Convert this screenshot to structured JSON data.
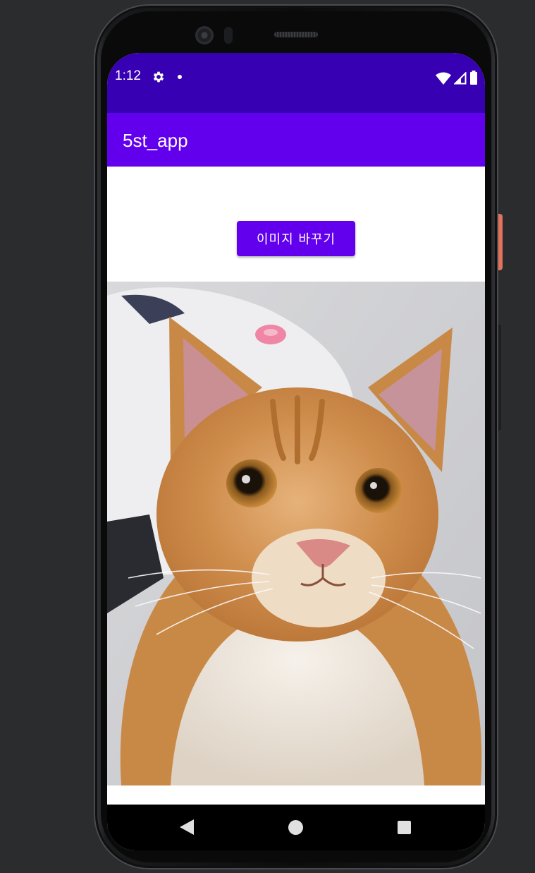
{
  "status_bar": {
    "time": "1:12",
    "icons": [
      "settings-gear-icon",
      "notification-dot-icon",
      "wifi-icon",
      "cell-signal-icon",
      "battery-icon"
    ]
  },
  "app_bar": {
    "title": "5st_app"
  },
  "main": {
    "change_image_button": "이미지 바꾸기",
    "image": "orange-tabby-cat-photo"
  },
  "nav_bar": {
    "icons": [
      "back-icon",
      "home-icon",
      "recents-icon"
    ]
  },
  "colors": {
    "primary": "#6200ee",
    "primary_dark": "#3700b3",
    "emulator_bg": "#2b2c2e"
  }
}
